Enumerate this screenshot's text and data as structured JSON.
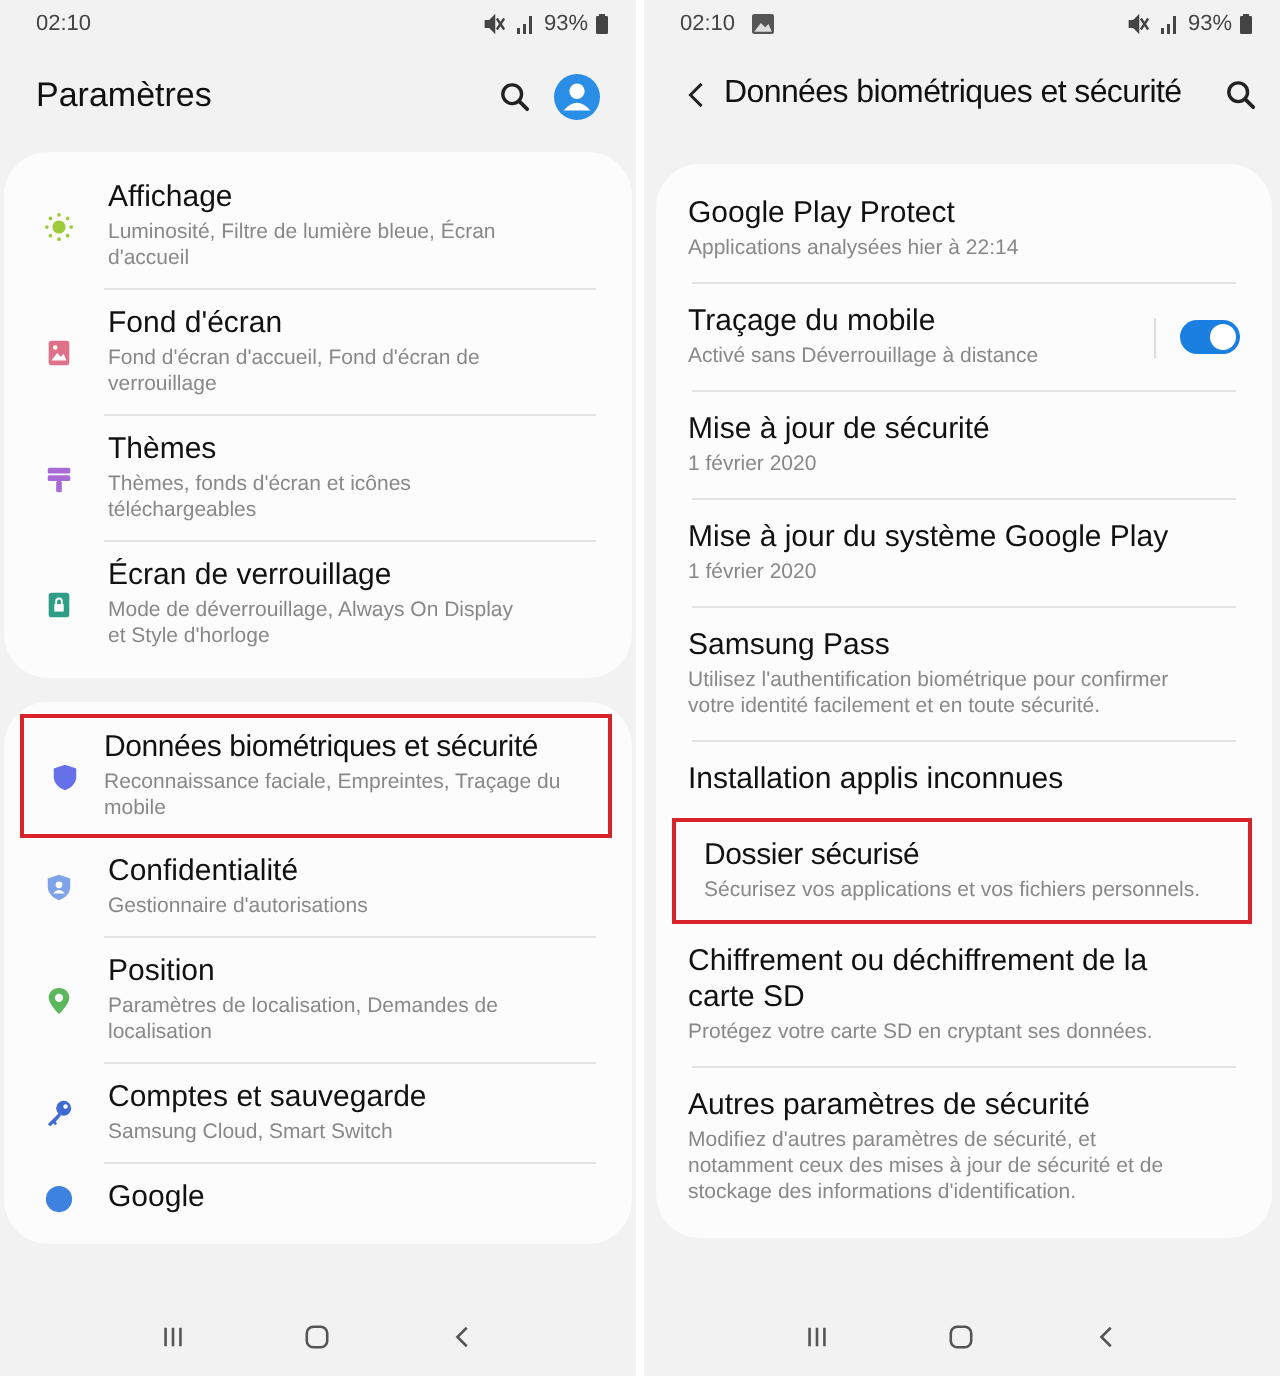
{
  "screens": [
    {
      "status_bar": {
        "time": "02:10",
        "battery": "93%"
      },
      "header": {
        "kind": "main",
        "title": "Paramètres"
      },
      "groups": [
        [
          {
            "kind": "sun",
            "color": "#9ccc3c",
            "title": "Affichage",
            "subtitle": "Luminosité, Filtre de lumière bleue, Écran d'accueil",
            "highlighted": false
          },
          {
            "kind": "wallpaper",
            "color": "#e0718a",
            "title": "Fond d'écran",
            "subtitle": "Fond d'écran d'accueil, Fond d'écran de verrouillage",
            "highlighted": false
          },
          {
            "kind": "theme",
            "color": "#a86bd6",
            "title": "Thèmes",
            "subtitle": "Thèmes, fonds d'écran et icônes téléchargeables",
            "highlighted": false
          },
          {
            "kind": "lock",
            "color": "#2e9e86",
            "title": "Écran de verrouillage",
            "subtitle": "Mode de déverrouillage, Always On Display et Style d'horloge",
            "highlighted": false
          }
        ],
        [
          {
            "kind": "shield",
            "color": "#6670e8",
            "title": "Données biométriques et sécurité",
            "subtitle": "Reconnaissance faciale, Empreintes, Traçage du mobile",
            "highlighted": true
          },
          {
            "kind": "privacy",
            "color": "#7fa3e8",
            "title": "Confidentialité",
            "subtitle": "Gestionnaire d'autorisations",
            "highlighted": false
          },
          {
            "kind": "pin",
            "color": "#5cb85c",
            "title": "Position",
            "subtitle": "Paramètres de localisation, Demandes de localisation",
            "highlighted": false
          },
          {
            "kind": "key",
            "color": "#3d6bd1",
            "title": "Comptes et sauvegarde",
            "subtitle": "Samsung Cloud, Smart Switch",
            "highlighted": false
          },
          {
            "kind": "google",
            "color": "#3e82e0",
            "title": "Google",
            "highlighted": false
          }
        ]
      ]
    },
    {
      "status_bar": {
        "time": "02:10",
        "battery": "93%",
        "notifications": [
          {
            "kind": "image"
          }
        ]
      },
      "header": {
        "kind": "sub",
        "title": "Données biométriques et sécurité"
      },
      "groups": [
        [
          {
            "title": "Google Play Protect",
            "subtitle": "Applications analysées hier à 22:14",
            "highlighted": false
          },
          {
            "title": "Traçage du mobile",
            "subtitle": "Activé sans Déverrouillage à distance",
            "highlighted": false,
            "toggle": {
              "on": true
            }
          },
          {
            "title": "Mise à jour de sécurité",
            "subtitle": "1 février 2020",
            "highlighted": false
          },
          {
            "title": "Mise à jour du système Google Play",
            "subtitle": "1 février 2020",
            "highlighted": false
          },
          {
            "title": "Samsung Pass",
            "subtitle": "Utilisez l'authentification biométrique pour confirmer votre identité facilement et en toute sécurité.",
            "highlighted": false
          },
          {
            "title": "Installation applis inconnues",
            "highlighted": false
          },
          {
            "title": "Dossier sécurisé",
            "subtitle": "Sécurisez vos applications et vos fichiers personnels.",
            "highlighted": true
          },
          {
            "title": "Chiffrement ou déchiffrement de la carte SD",
            "subtitle": "Protégez votre carte SD en cryptant ses données.",
            "highlighted": false
          },
          {
            "title": "Autres paramètres de sécurité",
            "subtitle": "Modifiez d'autres paramètres de sécurité, et notamment ceux des mises à jour de sécurité et de stockage des informations d'identification.",
            "highlighted": false
          }
        ]
      ]
    }
  ]
}
